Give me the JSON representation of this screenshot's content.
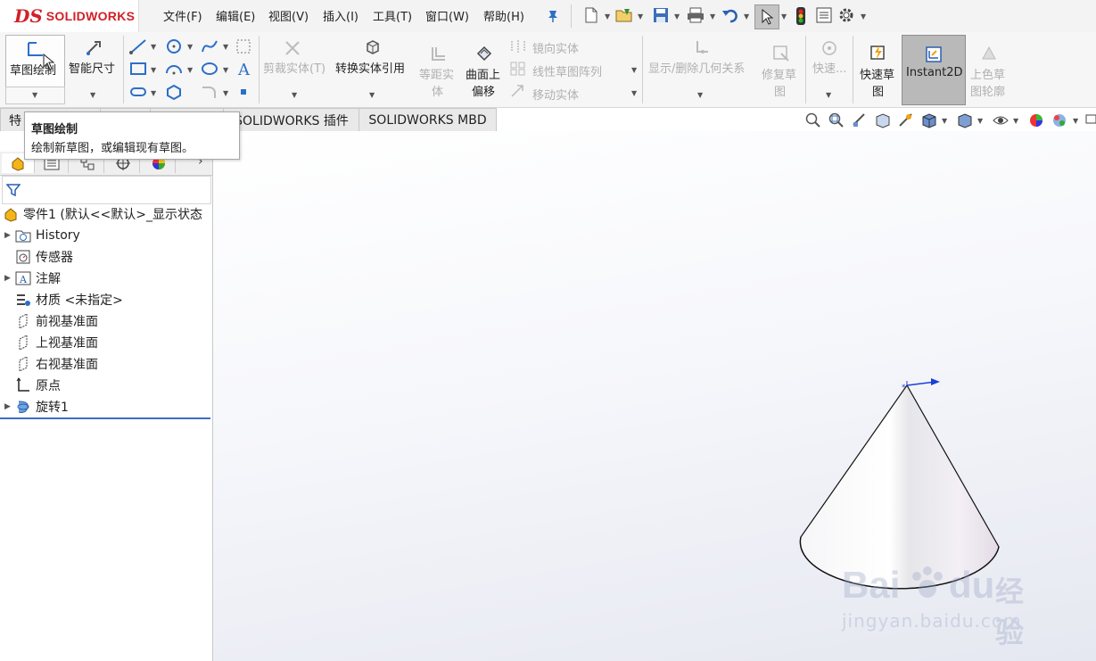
{
  "app": {
    "logo_mark": "DS",
    "logo_text": "SOLIDWORKS"
  },
  "menu": [
    "文件(F)",
    "编辑(E)",
    "视图(V)",
    "插入(I)",
    "工具(T)",
    "窗口(W)",
    "帮助(H)"
  ],
  "ribbon": {
    "sketch": "草图绘制",
    "smart_dim": "智能尺寸",
    "trim": "剪裁实体(T)",
    "convert": "转换实体引用",
    "offset_line1": "等距实",
    "offset_line2": "体",
    "surface_line1": "曲面上",
    "surface_line2": "偏移",
    "mirror": "镜向实体",
    "linear_pattern": "线性草图阵列",
    "move": "移动实体",
    "relations": "显示/删除几何关系",
    "repair_line1": "修复草",
    "repair_line2": "图",
    "quick_snap": "快速...",
    "rapid_line1": "快速草",
    "rapid_line2": "图",
    "instant2d": "Instant2D",
    "shaded_line1": "上色草",
    "shaded_line2": "图轮廓"
  },
  "tabs": [
    "特",
    "SOLIDWORKS 插件",
    "SOLIDWORKS MBD"
  ],
  "tooltip": {
    "title": "草图绘制",
    "desc": "绘制新草图，或编辑现有草图。"
  },
  "tree": {
    "root": "零件1 (默认<<默认>_显示状态",
    "items": [
      {
        "label": "History",
        "expandable": true,
        "icon": "history-folder-icon"
      },
      {
        "label": "传感器",
        "expandable": false,
        "icon": "sensor-icon"
      },
      {
        "label": "注解",
        "expandable": true,
        "icon": "annotation-icon"
      },
      {
        "label": "材质 <未指定>",
        "expandable": false,
        "icon": "material-icon"
      },
      {
        "label": "前视基准面",
        "expandable": false,
        "icon": "plane-icon"
      },
      {
        "label": "上视基准面",
        "expandable": false,
        "icon": "plane-icon"
      },
      {
        "label": "右视基准面",
        "expandable": false,
        "icon": "plane-icon"
      },
      {
        "label": "原点",
        "expandable": false,
        "icon": "origin-icon"
      },
      {
        "label": "旋转1",
        "expandable": true,
        "icon": "revolve-icon"
      }
    ]
  },
  "watermark": {
    "brand": "Bai",
    "brand2": "du",
    "cn": "经验",
    "url": "jingyan.baidu.com"
  },
  "colors": {
    "accent_red": "#d12027",
    "axis_blue": "#1a3fd6",
    "selected_btn": "#b9b9b9",
    "tree_line": "#3a6fc4"
  }
}
